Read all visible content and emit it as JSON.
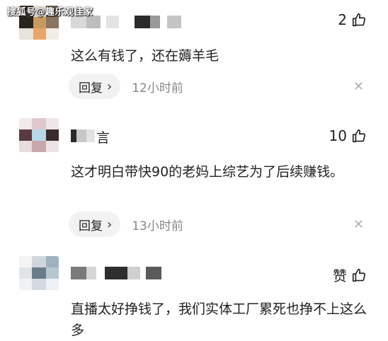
{
  "watermark": "搜狐号@趣乐观佳家",
  "comments": [
    {
      "like_count": "2",
      "text": "这么有钱了，还在薅羊毛",
      "reply_label": "回复",
      "time": "12小时前"
    },
    {
      "username_suffix": "言",
      "like_count": "10",
      "text": "这才明白带快90的老妈上综艺为了后续赚钱。",
      "reply_label": "回复",
      "time": "13小时前"
    },
    {
      "like_label": "赞",
      "text": "直播太好挣钱了，我们实体工厂累死也挣不上这么多"
    }
  ],
  "icons": {
    "like": "thumbs-up-icon",
    "close": "close-icon",
    "chevron": "chevron-right-icon"
  }
}
